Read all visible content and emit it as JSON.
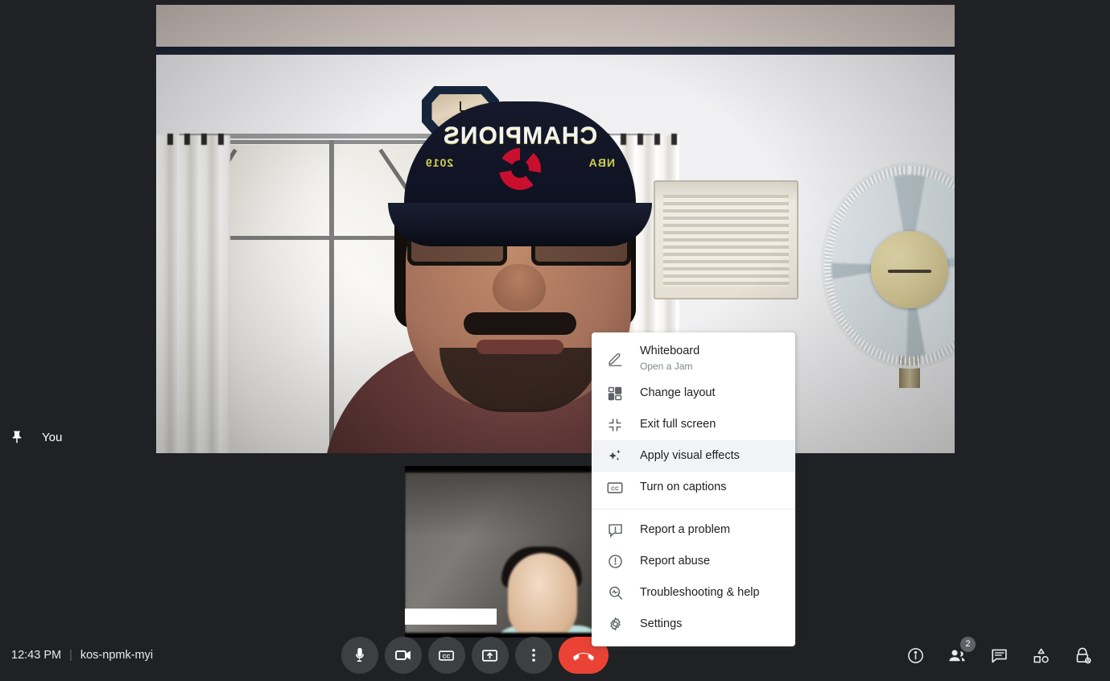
{
  "app": {
    "name": "Google Meet"
  },
  "main_tile": {
    "participant_label": "You",
    "pin_icon": "pin-icon"
  },
  "self_tile": {
    "name_redacted": ""
  },
  "more_menu": {
    "items": [
      {
        "id": "whiteboard",
        "icon": "pencil-icon",
        "label": "Whiteboard",
        "sublabel": "Open a Jam",
        "highlight": false
      },
      {
        "id": "change-layout",
        "icon": "layout-grid-icon",
        "label": "Change layout",
        "sublabel": "",
        "highlight": false
      },
      {
        "id": "exit-full-screen",
        "icon": "exit-fullscreen-icon",
        "label": "Exit full screen",
        "sublabel": "",
        "highlight": false
      },
      {
        "id": "visual-effects",
        "icon": "sparkle-icon",
        "label": "Apply visual effects",
        "sublabel": "",
        "highlight": true
      },
      {
        "id": "captions",
        "icon": "closed-caption-icon",
        "label": "Turn on captions",
        "sublabel": "",
        "highlight": false
      },
      {
        "id": "report-problem",
        "icon": "feedback-icon",
        "label": "Report a problem",
        "sublabel": "",
        "highlight": false
      },
      {
        "id": "report-abuse",
        "icon": "warning-circle-icon",
        "label": "Report abuse",
        "sublabel": "",
        "highlight": false
      },
      {
        "id": "troubleshooting",
        "icon": "troubleshoot-icon",
        "label": "Troubleshooting & help",
        "sublabel": "",
        "highlight": false
      },
      {
        "id": "settings",
        "icon": "gear-icon",
        "label": "Settings",
        "sublabel": "",
        "highlight": false
      }
    ]
  },
  "bottom_bar": {
    "time": "12:43 PM",
    "separator": "|",
    "meeting_code": "kos-npmk-myi",
    "center_controls": [
      {
        "id": "microphone",
        "icon": "microphone-icon",
        "label": "Turn off microphone"
      },
      {
        "id": "camera",
        "icon": "video-camera-icon",
        "label": "Turn off camera"
      },
      {
        "id": "captions",
        "icon": "closed-caption-icon",
        "label": "Turn on captions"
      },
      {
        "id": "present",
        "icon": "present-screen-icon",
        "label": "Present now"
      },
      {
        "id": "more-options",
        "icon": "more-vertical-icon",
        "label": "More options"
      },
      {
        "id": "leave-call",
        "icon": "hangup-icon",
        "label": "Leave call"
      }
    ],
    "right_controls": [
      {
        "id": "meeting-details",
        "icon": "info-icon",
        "label": "Meeting details",
        "badge": ""
      },
      {
        "id": "people",
        "icon": "people-icon",
        "label": "Show everyone",
        "badge": "2"
      },
      {
        "id": "chat",
        "icon": "chat-icon",
        "label": "Chat with everyone",
        "badge": ""
      },
      {
        "id": "activities",
        "icon": "activities-icon",
        "label": "Activities",
        "badge": ""
      },
      {
        "id": "host-controls",
        "icon": "lock-shield-icon",
        "label": "Host controls",
        "badge": ""
      }
    ],
    "leave_button_color": "#ea4335"
  },
  "video_scene": {
    "cap_text": "CHAMPIONS",
    "cap_left": "2019",
    "cap_right": "NBA"
  }
}
